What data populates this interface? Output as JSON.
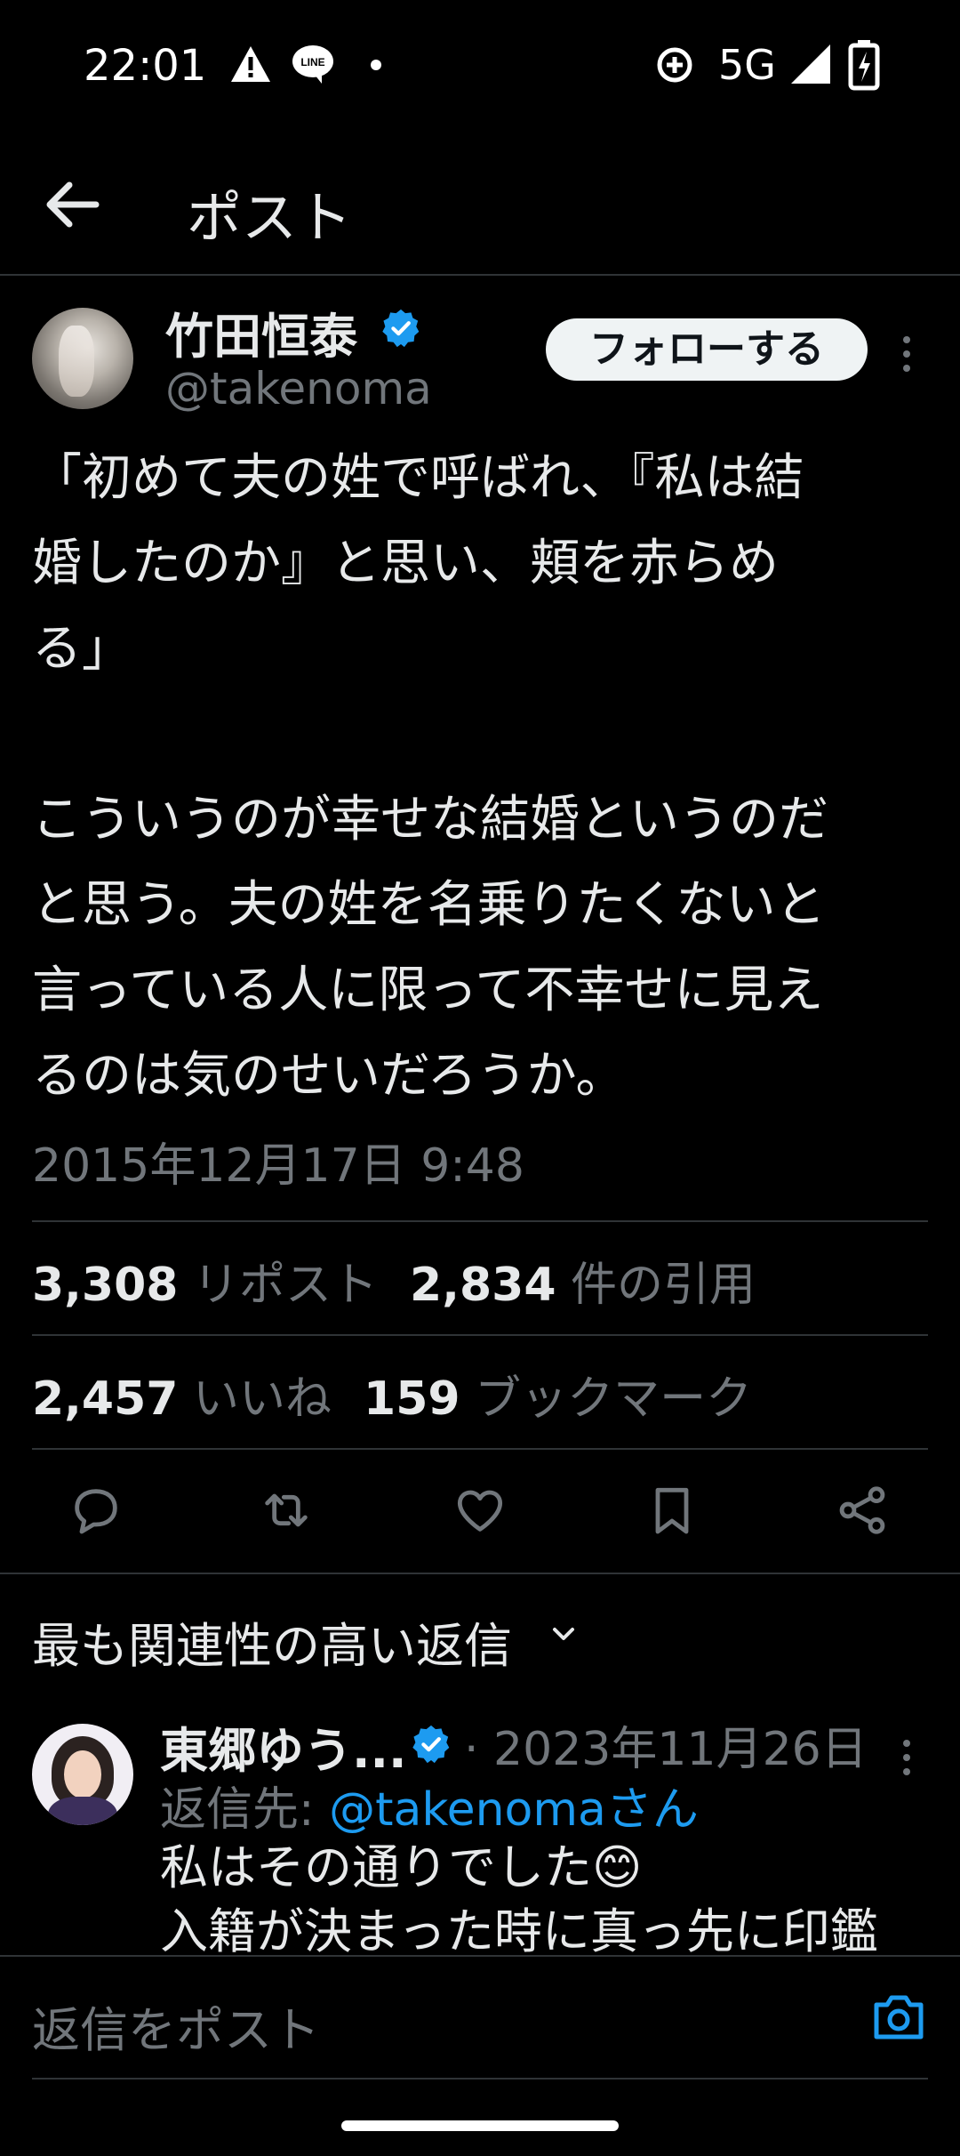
{
  "status_bar": {
    "time": "22:01",
    "network": "5G",
    "icons": [
      "warning-icon",
      "line-app-icon",
      "dot-icon",
      "data-saver-icon",
      "signal-icon",
      "battery-charging-icon"
    ]
  },
  "header": {
    "title": "ポスト",
    "back_icon": "arrow-left-icon"
  },
  "post": {
    "author_name": "竹田恒泰",
    "handle": "@takenoma",
    "verified": true,
    "follow_label": "フォローする",
    "text": "「初めて夫の姓で呼ばれ、『私は結\n婚したのか』と思い、頬を赤らめ\nる」\n\nこういうのが幸せな結婚というのだ\nと思う。夫の姓を名乗りたくないと\n言っている人に限って不幸せに見え\nるのは気のせいだろうか。",
    "timestamp": "2015年12月17日 9:48",
    "stats": {
      "reposts_count": "3,308",
      "reposts_label": "リポスト",
      "quotes_count": "2,834",
      "quotes_label": "件の引用",
      "likes_count": "2,457",
      "likes_label": "いいね",
      "bookmarks_count": "159",
      "bookmarks_label": "ブックマーク"
    },
    "actions": [
      "reply-icon",
      "repost-icon",
      "like-icon",
      "bookmark-icon",
      "share-icon"
    ]
  },
  "replies_section": {
    "title": "最も関連性の高い返信"
  },
  "reply": {
    "author_name": "東郷ゆう...",
    "verified": true,
    "date": "· 2023年11月26日",
    "reply_to_prefix": "返信先: ",
    "reply_to_mention": "@takenomaさん",
    "text": "私はその通りでした😊\n入籍が決まった時に真っ先に印鑑"
  },
  "composer": {
    "placeholder": "返信をポスト",
    "camera_icon": "camera-icon"
  },
  "colors": {
    "background": "#000000",
    "text_primary": "#e7e9ea",
    "text_secondary": "#71767b",
    "accent": "#1d9bf0",
    "divider": "#2f3336"
  }
}
